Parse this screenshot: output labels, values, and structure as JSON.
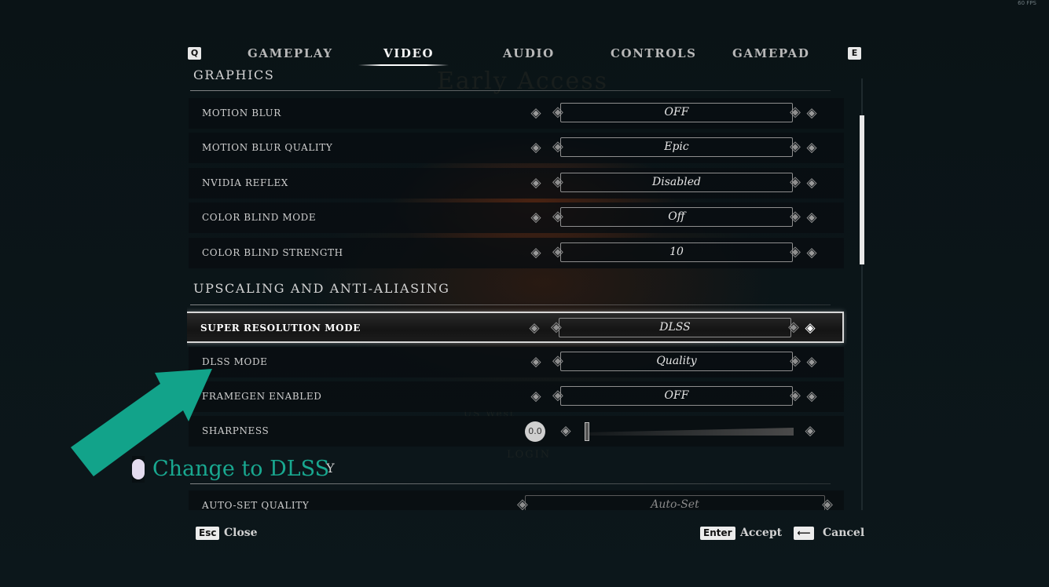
{
  "fps": "60 FPS",
  "background_text": {
    "title": "Early Access",
    "region": "US West",
    "login": "LOGIN"
  },
  "tabs": {
    "prev_key": "Q",
    "next_key": "E",
    "items": [
      {
        "label": "GAMEPLAY",
        "active": false
      },
      {
        "label": "VIDEO",
        "active": true
      },
      {
        "label": "AUDIO",
        "active": false
      },
      {
        "label": "CONTROLS",
        "active": false
      },
      {
        "label": "GAMEPAD",
        "active": false
      }
    ]
  },
  "sections": {
    "graphics": "GRAPHICS",
    "upscaling": "UPSCALING AND ANTI-ALIASING",
    "hidden_tail": "Y"
  },
  "settings": [
    {
      "label": "MOTION BLUR",
      "value": "OFF"
    },
    {
      "label": "MOTION BLUR QUALITY",
      "value": "Epic"
    },
    {
      "label": "NVIDIA REFLEX",
      "value": "Disabled"
    },
    {
      "label": "COLOR BLIND MODE",
      "value": "Off"
    },
    {
      "label": "COLOR BLIND STRENGTH",
      "value": "10"
    },
    {
      "label": "SUPER RESOLUTION MODE",
      "value": "DLSS",
      "selected": true
    },
    {
      "label": "DLSS MODE",
      "value": "Quality"
    },
    {
      "label": "FRAMEGEN ENABLED",
      "value": "OFF"
    },
    {
      "label": "SHARPNESS",
      "value": "0.0",
      "slider_level": 0.0
    },
    {
      "label": "AUTO-SET QUALITY",
      "value": "Auto-Set"
    }
  ],
  "icons": {
    "left": "arrow-left-icon",
    "right": "arrow-right-icon"
  },
  "callout": {
    "text": "Change to DLSS",
    "color": "#19a890"
  },
  "footer": {
    "close_key": "Esc",
    "close_label": "Close",
    "accept_key": "Enter",
    "accept_label": "Accept",
    "cancel_key": "⟵",
    "cancel_label": "Cancel"
  }
}
